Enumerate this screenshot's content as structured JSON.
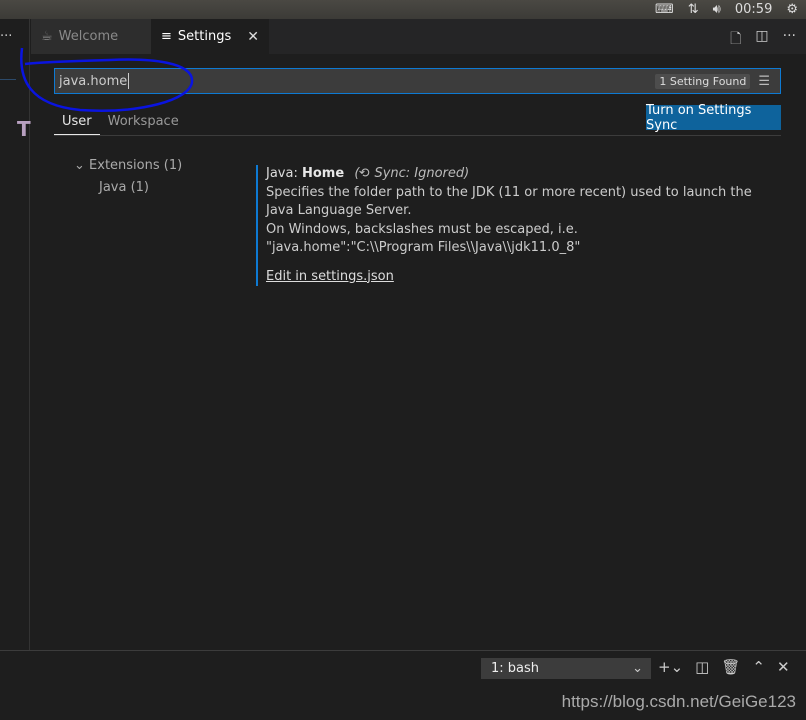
{
  "system_bar": {
    "time": "00:59",
    "icons": [
      "keyboard-icon",
      "network-icon",
      "volume-icon",
      "power-icon"
    ]
  },
  "left_pane": {
    "more": "···",
    "fragment": "T"
  },
  "tabs": [
    {
      "label": "Welcome",
      "icon": "coffee-cup-icon",
      "active": false
    },
    {
      "label": "Settings",
      "icon": "list-icon",
      "active": true,
      "close": "✕"
    }
  ],
  "tab_actions": [
    "open-json-icon",
    "split-editor-icon",
    "more-icon"
  ],
  "search": {
    "value": "java.home",
    "result_count": "1 Setting Found",
    "clear_icon": "clear-filter-icon"
  },
  "sync_button": "Turn on Settings Sync",
  "scope_tabs": [
    "User",
    "Workspace"
  ],
  "toc": {
    "group": "Extensions (1)",
    "item": "Java (1)"
  },
  "setting": {
    "category": "Java: ",
    "name": "Home",
    "sync": "Sync: Ignored",
    "description": [
      "Specifies the folder path to the JDK (11 or more recent) used to launch the Java Language Server.",
      "On Windows, backslashes must be escaped, i.e.",
      "\"java.home\":\"C:\\\\Program Files\\\\Java\\\\jdk11.0_8\""
    ],
    "link": "Edit in settings.json"
  },
  "terminal": {
    "selected": "1: bash"
  },
  "watermark": "https://blog.csdn.net/GeiGe123",
  "colors": {
    "accent": "#0e7ad3",
    "button": "#0e639c",
    "annotation": "#0a14e0"
  }
}
